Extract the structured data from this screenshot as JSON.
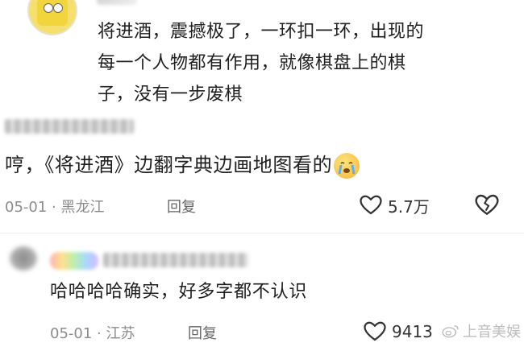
{
  "comments": [
    {
      "text_lines": [
        "将进酒，震撼极了，一环扣一环，出现的",
        "每一个人物都有作用，就像棋盘上的棋",
        "子，没有一步废棋"
      ]
    },
    {
      "text": "哼，《将进酒》边翻字典边画地图看的",
      "date": "05-01",
      "location": "黑龙江",
      "reply_label": "回复",
      "likes": "5.7万"
    },
    {
      "text": "哈哈哈哈确实，好多字都不认识",
      "date": "05-01",
      "location": "江苏",
      "reply_label": "回复",
      "likes": "9413"
    }
  ],
  "watermark": "上音美娱",
  "separator": " · ",
  "icons": [
    "heart-icon",
    "broken-heart-icon",
    "weibo-logo-icon",
    "crying-face-emoji-icon"
  ],
  "colors": {
    "text": "#1f1f1f",
    "meta": "#8c8c8c",
    "watermark": "#b5b5b5"
  }
}
